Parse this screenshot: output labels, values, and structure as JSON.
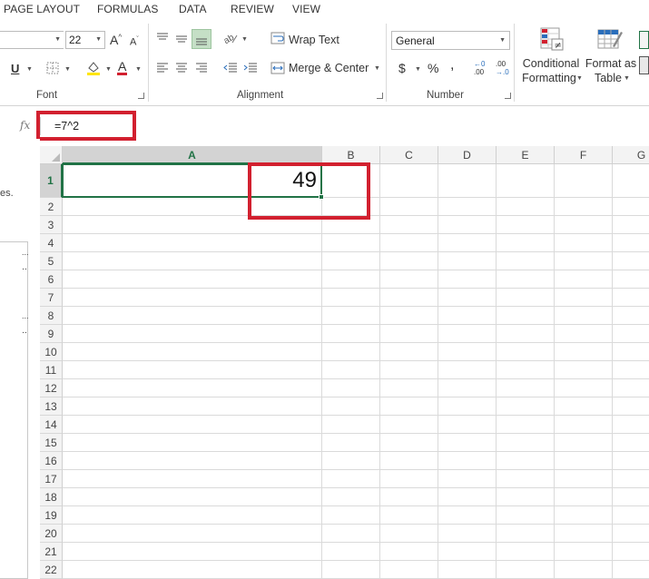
{
  "tabs": [
    "PAGE LAYOUT",
    "FORMULAS",
    "DATA",
    "REVIEW",
    "VIEW"
  ],
  "ribbon": {
    "font": {
      "group_label": "Font",
      "font_size": "22",
      "grow_font": "A",
      "shrink_font": "A",
      "underline": "U",
      "font_color_letter": "A"
    },
    "alignment": {
      "group_label": "Alignment",
      "wrap_text": "Wrap Text",
      "merge_center": "Merge & Center"
    },
    "number": {
      "group_label": "Number",
      "format": "General",
      "currency": "$",
      "percent": "%",
      "comma": ",",
      "inc_decimal_top": "←0",
      "inc_decimal_bottom": ".00",
      "dec_decimal_top": ".00",
      "dec_decimal_bottom": "→.0"
    },
    "styles": {
      "conditional_formatting_line1": "Conditional",
      "conditional_formatting_line2": "Formatting",
      "format_as_table_line1": "Format as",
      "format_as_table_line2": "Table"
    }
  },
  "formula_bar": {
    "fx_label": "fx",
    "formula": "=7^2"
  },
  "left_pane": {
    "fragment_top": "es.",
    "fragments": [
      "...",
      "‥",
      "...",
      "‥"
    ]
  },
  "sheet": {
    "columns": [
      "A",
      "B",
      "C",
      "D",
      "E",
      "F",
      "G"
    ],
    "selected_column": "A",
    "rows": [
      "1",
      "2",
      "3",
      "4",
      "5",
      "6",
      "7",
      "8",
      "9",
      "10",
      "11",
      "12",
      "13",
      "14",
      "15",
      "16",
      "17",
      "18",
      "19",
      "20",
      "21",
      "22"
    ],
    "selected_row": "1",
    "active_cell": "A1",
    "active_cell_value": "49"
  },
  "colors": {
    "excel_green": "#217346",
    "highlight_red": "#d2202f",
    "header_bg": "#f3f3f3"
  },
  "icons": {
    "dropdown": "chevron-down-icon",
    "fill_color": "paint-bucket-icon",
    "borders": "borders-icon",
    "orientation": "text-orientation-icon",
    "indent": "indent-icon",
    "conditional_formatting": "conditional-formatting-icon",
    "format_as_table": "format-as-table-icon"
  }
}
